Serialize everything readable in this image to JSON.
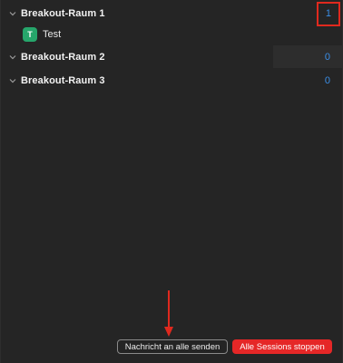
{
  "rooms": [
    {
      "name": "Breakout-Raum 1",
      "count": "1",
      "expanded": true,
      "participants": [
        {
          "initial": "T",
          "name": "Test",
          "avatar_color": "#26a66b"
        }
      ]
    },
    {
      "name": "Breakout-Raum 2",
      "count": "0",
      "expanded": false
    },
    {
      "name": "Breakout-Raum 3",
      "count": "0",
      "expanded": false
    }
  ],
  "footer": {
    "message_all_label": "Nachricht an alle senden",
    "stop_all_label": "Alle Sessions stoppen"
  },
  "colors": {
    "background": "#252525",
    "count_text": "#3b8ee6",
    "stop_button": "#e52727",
    "annotation": "#e0291e"
  },
  "icons": {
    "room_toggle": "chevron-down-icon",
    "annotation_arrow": "arrow-down-icon"
  }
}
